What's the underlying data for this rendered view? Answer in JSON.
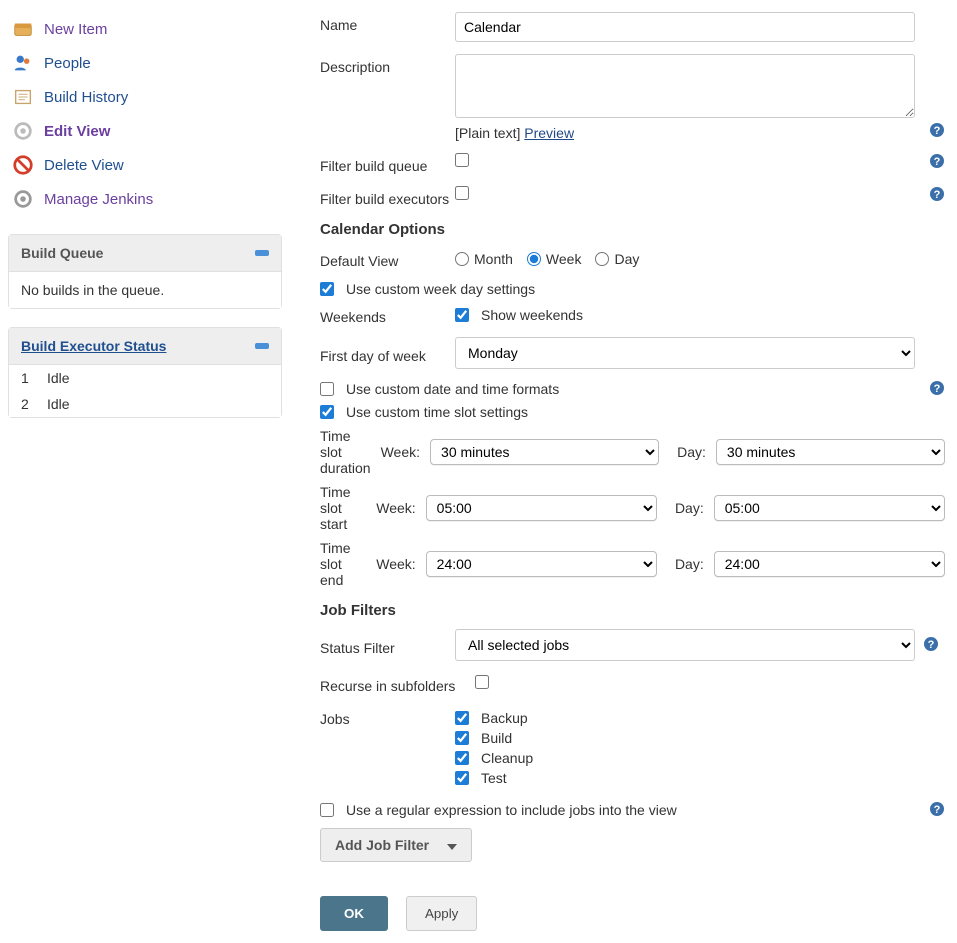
{
  "sidebar": {
    "nav": [
      {
        "label": "New Item",
        "icon": "new-item"
      },
      {
        "label": "People",
        "icon": "people"
      },
      {
        "label": "Build History",
        "icon": "build-history"
      },
      {
        "label": "Edit View",
        "icon": "edit-view"
      },
      {
        "label": "Delete View",
        "icon": "delete-view"
      },
      {
        "label": "Manage Jenkins",
        "icon": "manage-jenkins"
      }
    ],
    "buildQueue": {
      "title": "Build Queue",
      "empty": "No builds in the queue."
    },
    "executor": {
      "title": "Build Executor Status",
      "executors": [
        {
          "num": "1",
          "status": "Idle"
        },
        {
          "num": "2",
          "status": "Idle"
        }
      ]
    }
  },
  "form": {
    "labels": {
      "name": "Name",
      "description": "Description",
      "plainText": "[Plain text]",
      "preview": "Preview",
      "filterBuildQueue": "Filter build queue",
      "filterBuildExecutors": "Filter build executors"
    },
    "values": {
      "name": "Calendar",
      "description": ""
    }
  },
  "calendar": {
    "sectionTitle": "Calendar Options",
    "defaultViewLabel": "Default View",
    "viewOptions": {
      "month": "Month",
      "week": "Week",
      "day": "Day"
    },
    "selectedView": "week",
    "useCustomWeekday": "Use custom week day settings",
    "weekendsLabel": "Weekends",
    "showWeekends": "Show weekends",
    "firstDayLabel": "First day of week",
    "firstDayValue": "Monday",
    "useCustomDate": "Use custom date and time formats",
    "useCustomTimeSlot": "Use custom time slot settings",
    "timeSlotDurationLabel": "Time slot duration",
    "timeSlotStartLabel": "Time slot start",
    "timeSlotEndLabel": "Time slot end",
    "weekLabel": "Week:",
    "dayLabel": "Day:",
    "durationWeek": "30 minutes",
    "durationDay": "30 minutes",
    "startWeek": "05:00",
    "startDay": "05:00",
    "endWeek": "24:00",
    "endDay": "24:00"
  },
  "jobFilters": {
    "sectionTitle": "Job Filters",
    "statusFilterLabel": "Status Filter",
    "statusFilterValue": "All selected jobs",
    "recurseLabel": "Recurse in subfolders",
    "jobsLabel": "Jobs",
    "jobs": [
      "Backup",
      "Build",
      "Cleanup",
      "Test"
    ],
    "useRegex": "Use a regular expression to include jobs into the view",
    "addJobFilter": "Add Job Filter"
  },
  "buttons": {
    "ok": "OK",
    "apply": "Apply"
  }
}
